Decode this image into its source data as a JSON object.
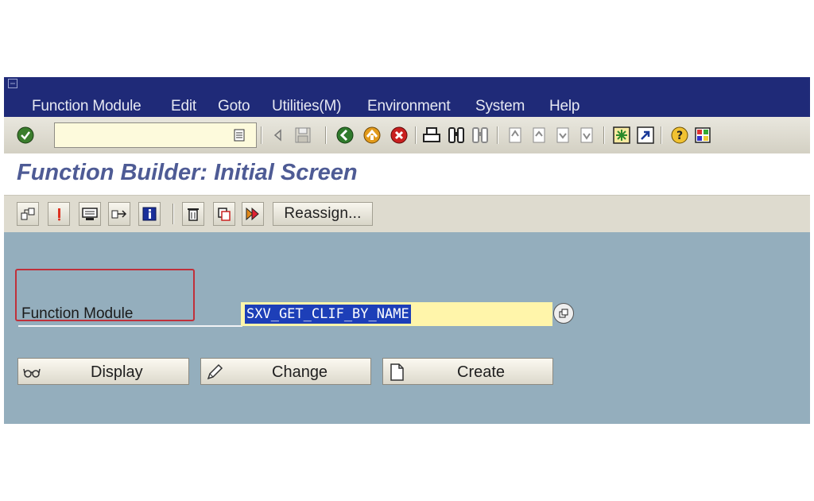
{
  "menu": {
    "items": [
      "Function Module",
      "Edit",
      "Goto",
      "Utilities(M)",
      "Environment",
      "System",
      "Help"
    ]
  },
  "standard_toolbar": {
    "command_field_value": "",
    "icons": [
      "enter-icon",
      "command-history-icon",
      "back-arrow-icon",
      "save-icon",
      "back-icon",
      "exit-icon",
      "cancel-icon",
      "print-icon",
      "find-icon",
      "find-next-icon",
      "first-page-icon",
      "previous-page-icon",
      "next-page-icon",
      "last-page-icon",
      "new-session-icon",
      "shortcut-icon",
      "help-icon",
      "layout-menu-icon"
    ]
  },
  "title": {
    "text": "Function Builder: Initial Screen"
  },
  "app_toolbar": {
    "icons": [
      "other-object-icon",
      "active-inactive-icon",
      "test-icon",
      "where-used-icon",
      "info-icon",
      "delete-icon",
      "copy-icon",
      "rename-icon"
    ],
    "reassign_label": "Reassign..."
  },
  "form": {
    "function_module_label": "Function Module",
    "function_module_value": "SXV_GET_CLIF_BY_NAME"
  },
  "buttons": {
    "display_label": "Display",
    "change_label": "Change",
    "create_label": "Create"
  },
  "colors": {
    "menu_bar": "#1f2a78",
    "title_text": "#4e5b95",
    "work_area": "#94aebd",
    "input_bg": "#fff5aa",
    "selection": "#1d3fb8",
    "highlight_box": "#c0303a"
  }
}
